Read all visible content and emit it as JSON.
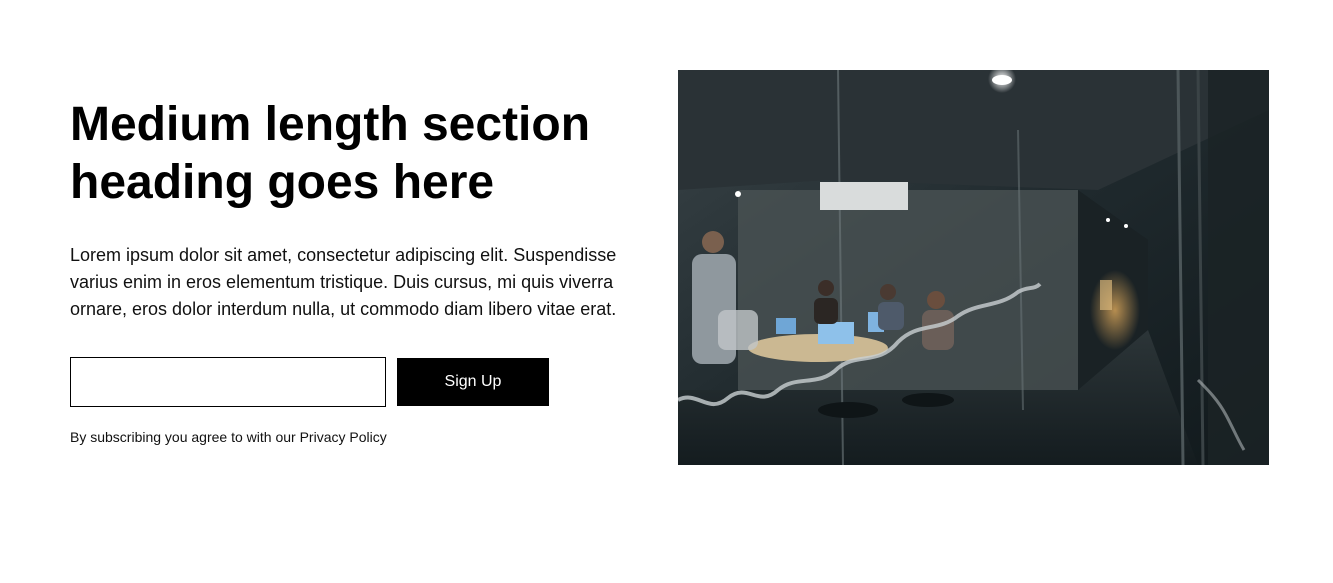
{
  "header": {
    "title": "Medium length section heading goes here"
  },
  "main": {
    "description": "Lorem ipsum dolor sit amet, consectetur adipiscing elit. Suspendisse varius enim in eros elementum tristique. Duis cursus, mi quis viverra ornare, eros dolor interdum nulla, ut commodo diam libero vitae erat.",
    "form": {
      "email_value": "",
      "email_placeholder": "",
      "submit_label": "Sign Up"
    },
    "terms": {
      "prefix": "By subscribing you agree to with our",
      "link_label": "Privacy Policy"
    }
  },
  "image": {
    "subject": "office-meeting-photo"
  },
  "colors": {
    "background": "#ffffff",
    "text": "#000000",
    "button_bg": "#000000",
    "button_text": "#ffffff"
  }
}
